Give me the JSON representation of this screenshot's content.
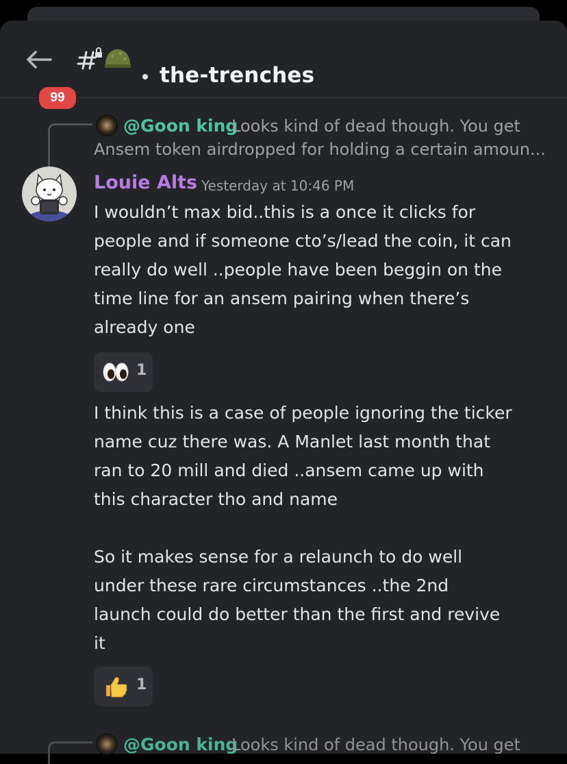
{
  "header": {
    "unread_count": "99",
    "channel_name": "the-trenches"
  },
  "reply": {
    "author": "@Goon king",
    "preview_line1": "Looks kind of dead though. You get",
    "preview_line2": "Ansem token airdropped for holding a certain amoun..."
  },
  "message": {
    "author": "Louie Alts",
    "timestamp": "Yesterday at 10:46 PM",
    "lines": [
      "I wouldn’t max bid..this is a once it clicks for",
      "people and if someone cto’s/lead the coin, it can",
      "really do well ..people have been beggin on the",
      "time line for an ansem pairing when there’s",
      "already one"
    ],
    "reaction": {
      "icon": "eyes-emoji",
      "count": "1"
    }
  },
  "message2": {
    "lines": [
      "I think this is a case of people ignoring the ticker",
      "name cuz there was. A Manlet last month that",
      "ran to 20 mill and died ..ansem came up with",
      "this character tho and name",
      "",
      "So it makes sense for a relaunch to do well",
      "under  these rare circumstances ..the 2nd",
      "launch could do better than the first and revive",
      "it"
    ],
    "reaction": {
      "icon": "thumbs-up-emoji",
      "count": "1"
    }
  },
  "next_reply": {
    "author": "@Goon king",
    "preview": "Looks kind of dead though. You get"
  },
  "colors": {
    "background": "#232428",
    "author_purple": "#b97ce0",
    "reply_author_green": "#4fc3a1",
    "badge_red": "#e04745"
  }
}
